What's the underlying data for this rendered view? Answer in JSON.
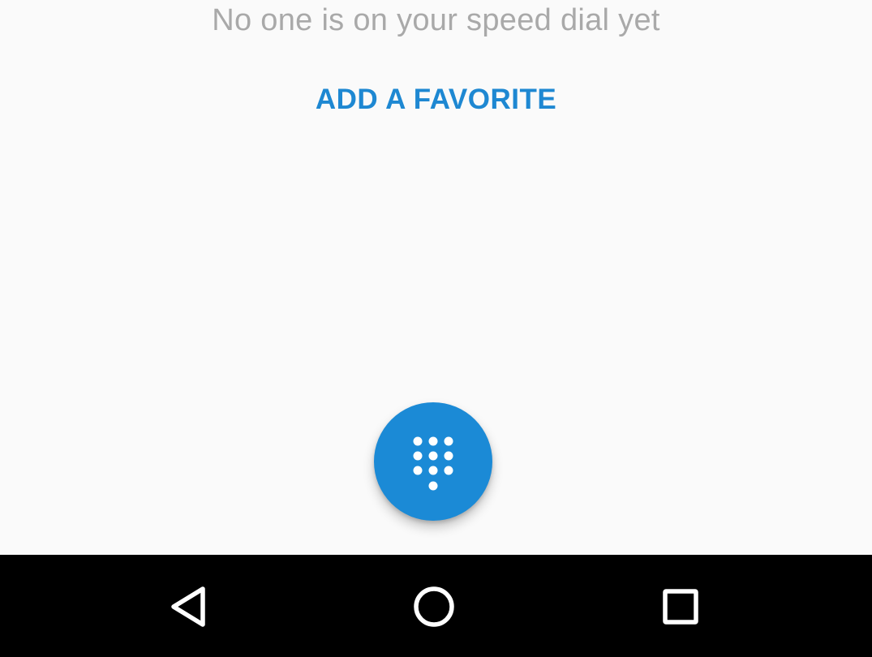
{
  "favorites": {
    "empty_message": "No one is on your speed dial yet",
    "add_favorite_label": "ADD A FAVORITE"
  },
  "fab": {
    "icon": "dialpad-icon",
    "color": "#1b8ad6"
  },
  "navigation_bar": {
    "back_icon": "back-triangle-icon",
    "home_icon": "home-circle-icon",
    "recents_icon": "recents-square-icon"
  },
  "colors": {
    "accent": "#1e88d2",
    "background": "#fafafa",
    "muted_text": "#a9a9a9",
    "navbar": "#000000"
  }
}
